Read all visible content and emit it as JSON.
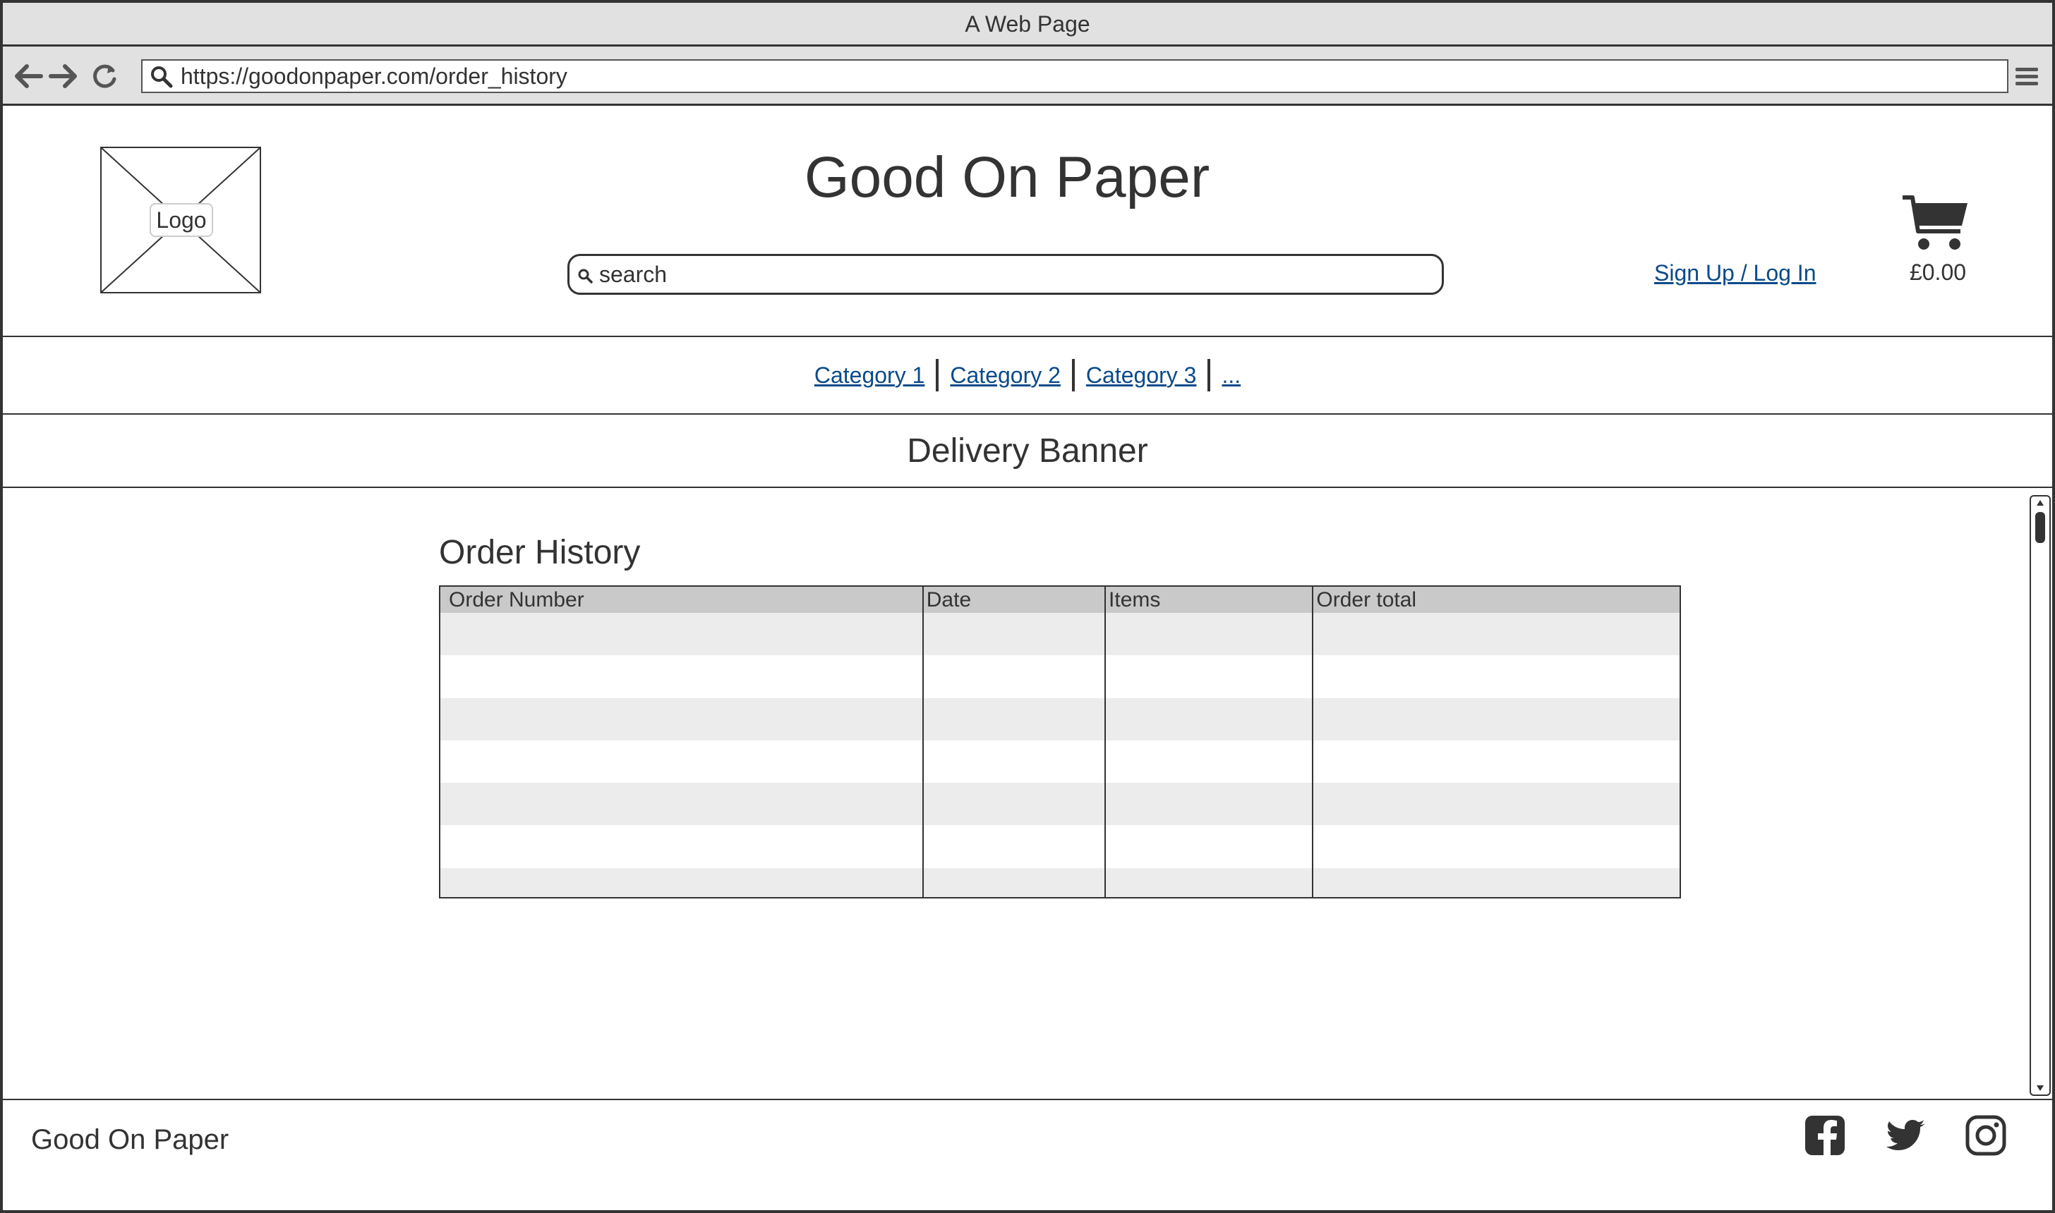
{
  "window": {
    "title": "A Web Page"
  },
  "browser": {
    "url": "https://goodonpaper.com/order_history",
    "icons": [
      "back-arrow-icon",
      "forward-arrow-icon",
      "reload-icon",
      "search-icon",
      "hamburger-menu-icon"
    ]
  },
  "header": {
    "logo_label": "Logo",
    "site_title": "Good On Paper",
    "search_placeholder": "search",
    "auth_link": "Sign Up / Log In",
    "cart_total": "£0.00",
    "cart_icon": "shopping-cart-icon"
  },
  "nav": {
    "categories": [
      "Category 1",
      "Category 2",
      "Category 3",
      "..."
    ]
  },
  "banner": {
    "text": "Delivery Banner"
  },
  "main": {
    "heading": "Order History",
    "table": {
      "columns": [
        "Order Number",
        "Date",
        "Items",
        "Order total"
      ],
      "rows": [
        [
          "",
          "",
          "",
          ""
        ],
        [
          "",
          "",
          "",
          ""
        ],
        [
          "",
          "",
          "",
          ""
        ],
        [
          "",
          "",
          "",
          ""
        ],
        [
          "",
          "",
          "",
          ""
        ],
        [
          "",
          "",
          "",
          ""
        ],
        [
          "",
          "",
          "",
          ""
        ]
      ]
    }
  },
  "footer": {
    "brand": "Good On Paper",
    "social_icons": [
      "facebook-icon",
      "twitter-icon",
      "instagram-icon"
    ]
  },
  "colors": {
    "link": "#0b4a8a",
    "chrome": "#e1e1e1",
    "table_header": "#c9c9c9",
    "table_alt_row": "#ececec",
    "ink": "#333333"
  }
}
